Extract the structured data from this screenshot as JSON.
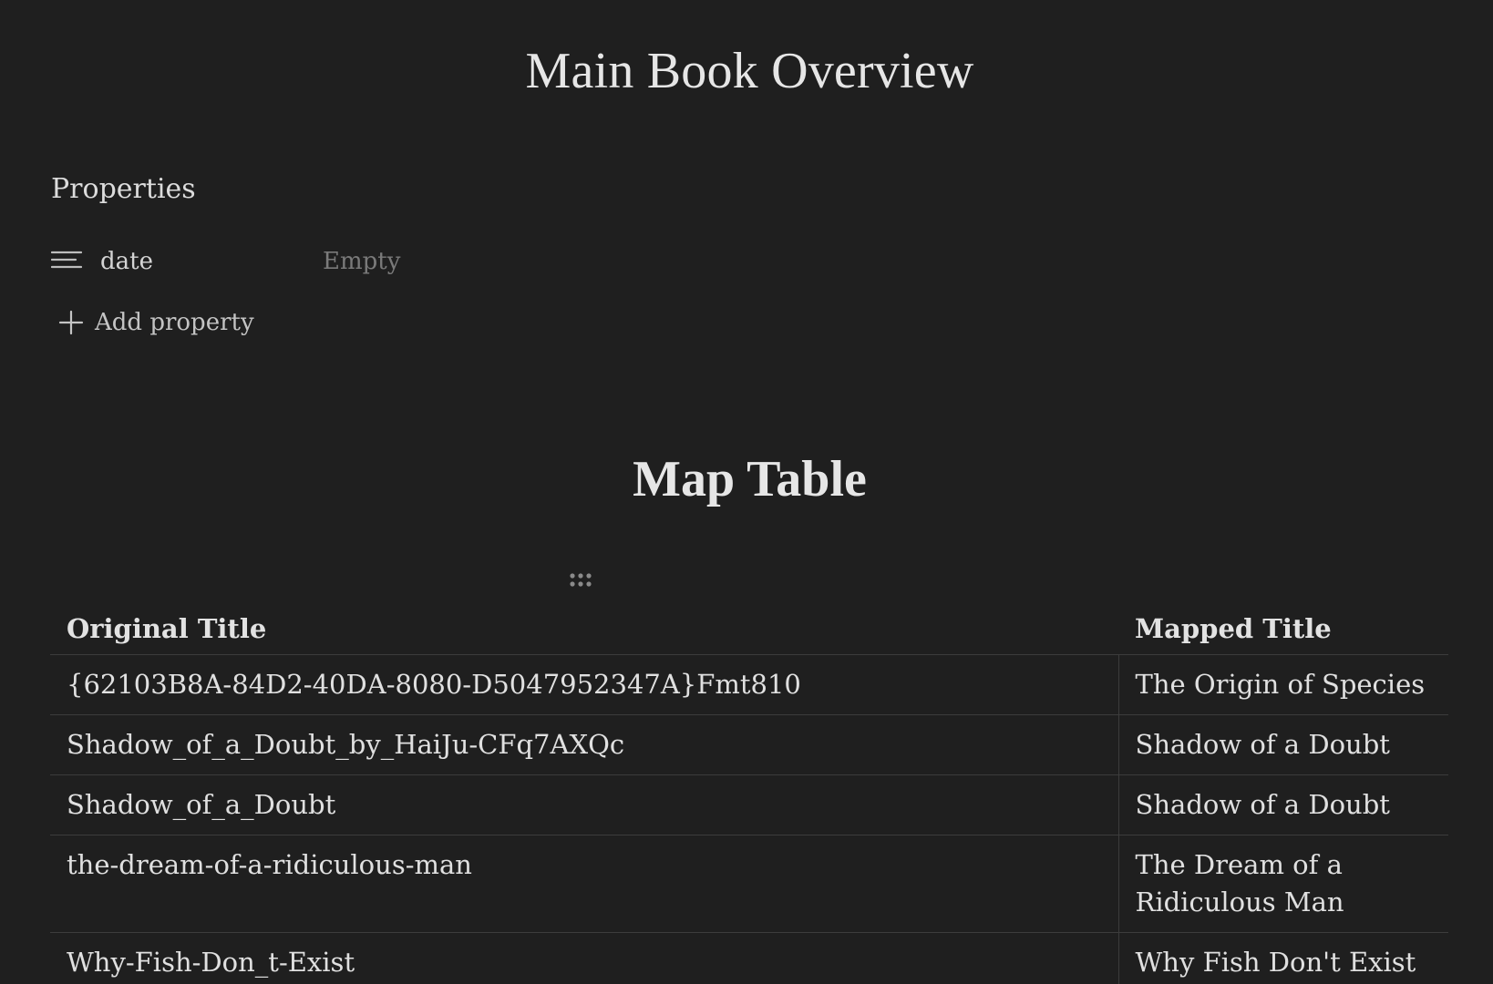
{
  "page": {
    "title": "Main Book Overview"
  },
  "properties": {
    "heading": "Properties",
    "items": [
      {
        "icon": "text-lines-icon",
        "name": "date",
        "value": "Empty"
      }
    ],
    "add_label": "Add property"
  },
  "map_table": {
    "heading": "Map Table",
    "columns": [
      "Original Title",
      "Mapped Title"
    ],
    "rows": [
      [
        "{62103B8A-84D2-40DA-8080-D5047952347A}Fmt810",
        "The Origin of Species"
      ],
      [
        "Shadow_of_a_Doubt_by_HaiJu-CFq7AXQc",
        "Shadow of a Doubt"
      ],
      [
        "Shadow_of_a_Doubt",
        "Shadow of a Doubt"
      ],
      [
        "the-dream-of-a-ridiculous-man",
        "The Dream of a Ridiculous Man"
      ],
      [
        "Why-Fish-Don_t-Exist",
        "Why Fish Don't Exist"
      ]
    ]
  },
  "colors": {
    "background": "#1f1f1f",
    "text": "#dadada",
    "muted": "#7a7a7a",
    "border": "#3c3c3c"
  }
}
